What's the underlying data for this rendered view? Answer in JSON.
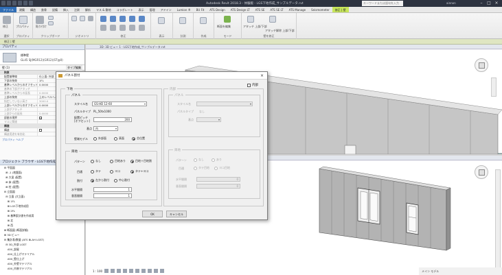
{
  "app": {
    "title": "Autodesk Revit 2018.3 - 体験版 - LGS下地作成_サンプルデータ.rvt",
    "search_placeholder": "キーワードまたは語句を入力",
    "user": "ainnon"
  },
  "tabs": [
    "ファイル",
    "建築",
    "構造",
    "鉄骨",
    "設備",
    "挿入",
    "注釈",
    "解析",
    "マス & 敷地",
    "コラボレート",
    "表示",
    "管理",
    "アドイン",
    "Lumion ®",
    "BU Fit",
    "ATS Design",
    "ATS Design LT",
    "ATS SE",
    "ATS SE LT",
    "ATS Manage",
    "Seismometer",
    "修正 | 壁"
  ],
  "ribbon": {
    "groups": [
      {
        "label": "選択",
        "items": [
          "修正"
        ]
      },
      {
        "label": "プロパティ",
        "items": [
          "プロパティ"
        ]
      },
      {
        "label": "クリップボード",
        "items": [
          "貼り付け"
        ]
      },
      {
        "label": "ジオメトリ",
        "items": [
          "結合"
        ]
      },
      {
        "label": "修正",
        "items": []
      },
      {
        "label": "表示",
        "items": []
      },
      {
        "label": "計測",
        "items": []
      },
      {
        "label": "作成",
        "items": []
      },
      {
        "label": "モード",
        "items": [
          "断面を編集",
          "壁の結合"
        ]
      },
      {
        "label": "壁を修正",
        "items": [
          "アタッチ 上部/下部",
          "アタッチ解除 上部/下部"
        ]
      }
    ]
  },
  "modify_bar": "修正 | 壁",
  "properties": {
    "header": "プロパティ",
    "type_line1": "標準壁",
    "type_line2": "GL45 SJ(MGR12)(GR12)(ST@0)",
    "instance": "壁 (1)",
    "edit_type": "タイプ編集",
    "rows": [
      {
        "k": "拘束",
        "v": "",
        "cat": true
      },
      {
        "k": "配置基準線",
        "v": "仕上面: 外部"
      },
      {
        "k": "下部の拘束",
        "v": "1FL"
      },
      {
        "k": "基準レベルからのオフセット",
        "v": "0.0000"
      },
      {
        "k": "基準の下部がアタッチ",
        "v": "",
        "dim": true
      },
      {
        "k": "基準レベルからの延長",
        "v": "0.0000",
        "dim": true
      },
      {
        "k": "上部の拘束",
        "v": "上のレベルへ: 2FL"
      },
      {
        "k": "指定していない高さ",
        "v": "3000.0",
        "dim": true
      },
      {
        "k": "上部レベルからのオフセット",
        "v": "0.0000"
      },
      {
        "k": "上部がアタッチ",
        "v": "",
        "dim": true
      },
      {
        "k": "上部からの延長",
        "v": "0.0000",
        "dim": true
      },
      {
        "k": "部屋の境界",
        "v": "check"
      },
      {
        "k": "マスに関連",
        "v": "",
        "dim": true
      },
      {
        "k": "構造",
        "v": "",
        "cat": true
      },
      {
        "k": "構造",
        "v": "box"
      },
      {
        "k": "構造用途を有効化",
        "v": "",
        "dim": true
      }
    ],
    "help_link": "プロパティ ヘルプ"
  },
  "browser": {
    "header": "プロジェクト ブラウザ - LGS下地作成_サンプル...",
    "items": [
      "⊟ 平面図",
      "  ⊞ -1 (地盤面)",
      "  ⊞ 大梁 (配置)",
      "  ⊞ 床 (配置)",
      "  ⊞ 柱 (配置)",
      "⊟ 立面図",
      "  ⊟ 立面 (大立面)",
      "    ⊞ 1FL",
      "    ⊞ LGS下地作成用",
      "    ⊞ 2FL",
      "    ⊞ 基準設計書を作成用",
      "    ⊞ 北",
      "    ⊞ 西",
      "⊞ 断面図 (断面詳細)",
      "⊞ 3D ビュー",
      "⊟ 集計表/数量 (ATS BLAH LGST)",
      "  ⊟ 3D_外部 LGST",
      "    A50_部屋",
      "    A50_仕上げマテリアル",
      "    A50_壁仕上げ",
      "    A50_外壁マテリアル",
      "    A50_内装マテリアル"
    ]
  },
  "views": {
    "top_title": "3D: 3D ビュー 1 - LGS下地作成_サンプルデータ.rvt",
    "bottom_title": "3D: {3D}",
    "scale": "1 : 100"
  },
  "status": {
    "text": "メイン モデル"
  },
  "dialog": {
    "title": "パネル割付",
    "close": "×",
    "left_group": "下地",
    "panel_group": "パネル",
    "style_label": "スタイル名",
    "style_value": "GS-HD 12-60",
    "panel_type_label": "パネルタイプ",
    "panel_type_value": "PL_50tx1000",
    "spacing_label": "配置ピッチ",
    "spacing_label2": "[オフセット]",
    "spacing_value": "200",
    "kind_label": "基点",
    "kind_value": "内",
    "option_label": "壁端モデル",
    "option_radios": [
      "外部面",
      "表面",
      "芯位置"
    ],
    "option_selected": 2,
    "ext_group": "目地",
    "pattern_label": "パターン",
    "pattern_radios": [
      "なし",
      "目地あり",
      "目地＋目地割"
    ],
    "pattern_selected": 2,
    "type_label": "目通",
    "type_radios": [
      "タテ",
      "ヨコ",
      "タテ+ヨコ"
    ],
    "type_selected": 2,
    "align_label": "割付",
    "align_radios": [
      "左から割付",
      "中心割付"
    ],
    "align_selected": 0,
    "h_label": "水平間隔",
    "h_value": "1",
    "v_label": "垂直間隔",
    "v_value": "1",
    "right_check": "内部",
    "right_group": "内部",
    "r_panel_group": "パネル",
    "r_style_label": "スタイル名",
    "r_type_label": "パネルタイプ",
    "r_type_value": "なし",
    "r_kind_label": "基点",
    "r_joint_group": "目地",
    "r_pattern_label": "パターン",
    "r_pattern_radios": [
      "なし",
      "あり"
    ],
    "r_type_row_label": "目通",
    "r_type_radios": [
      "タテ目地",
      "ヨコ目地"
    ],
    "r_h_label": "水平間隔",
    "r_h_value": "0",
    "r_v_label": "垂直間隔",
    "r_v_value": "0",
    "ok": "OK",
    "cancel": "キャンセル"
  },
  "colors": {
    "accent": "#2f6db5",
    "active_tab": "#c8e65a",
    "wall": "#c0c0c0"
  }
}
